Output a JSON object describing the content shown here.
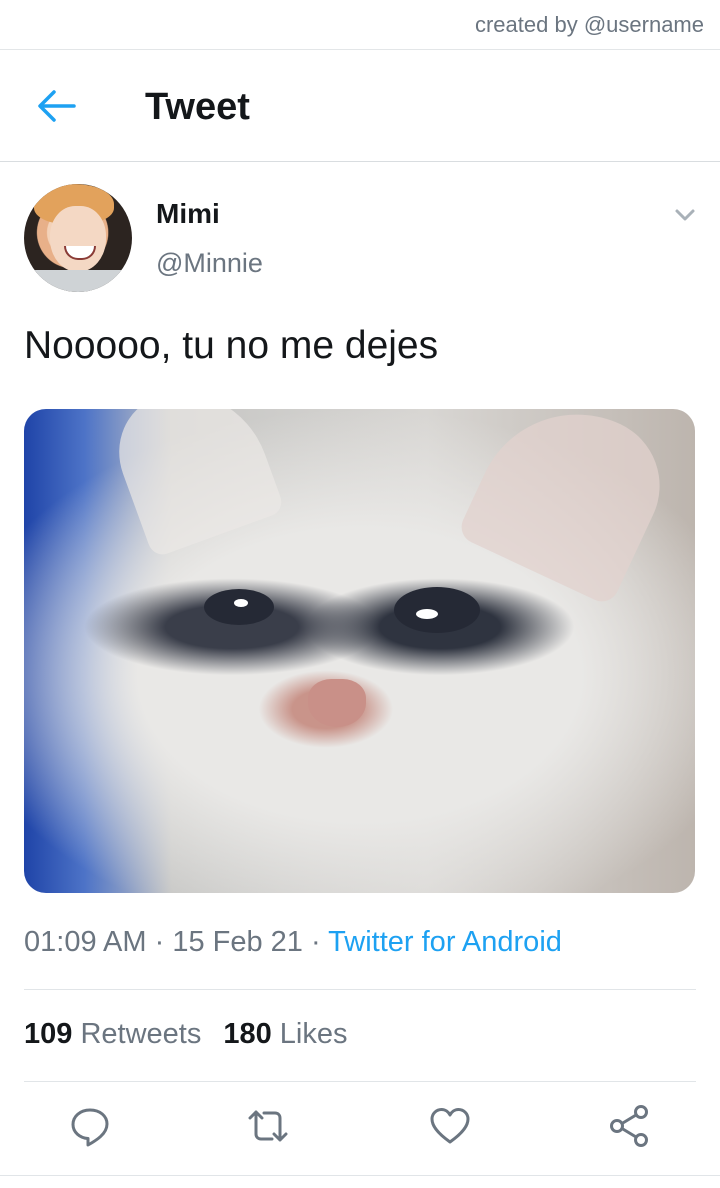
{
  "watermark": "created by @username",
  "header": {
    "title": "Tweet"
  },
  "tweet": {
    "display_name": "Mimi",
    "handle": "@Minnie",
    "text": "Nooooo, tu no me dejes",
    "time": "01:09 AM",
    "date": "15 Feb 21",
    "source": "Twitter for Android",
    "separator": " · ",
    "retweets_count": "109",
    "retweets_label": "Retweets",
    "likes_count": "180",
    "likes_label": "Likes"
  },
  "icons": {
    "back": "arrow-left-icon",
    "more": "chevron-down-icon",
    "reply": "reply-icon",
    "retweet": "retweet-icon",
    "like": "heart-icon",
    "share": "share-icon"
  },
  "colors": {
    "accent": "#1da1f2",
    "secondary_text": "#6b7580",
    "primary_text": "#14171a"
  }
}
